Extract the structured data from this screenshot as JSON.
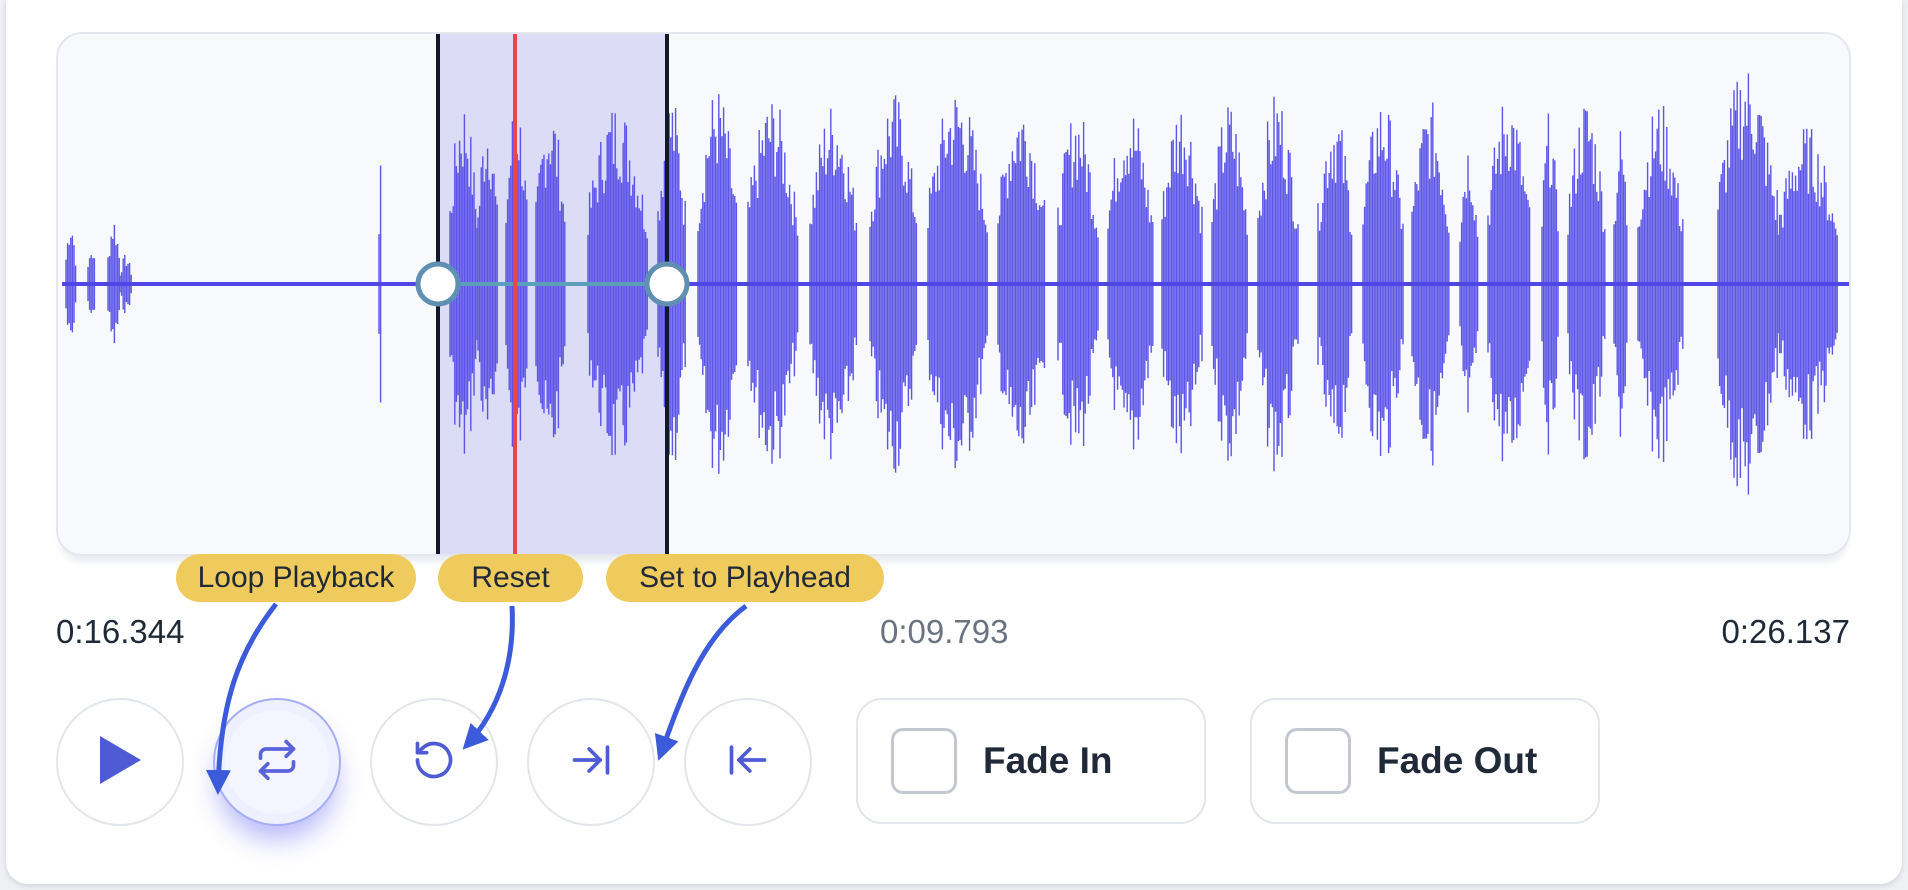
{
  "player": {
    "times": {
      "start": "0:16.344",
      "current": "0:09.793",
      "end": "0:26.137"
    },
    "controls": {
      "play_icon": "play-icon",
      "loop_icon": "loop-icon",
      "reset_icon": "reset-icon",
      "set_end_icon": "skip-to-end-icon",
      "set_start_icon": "skip-to-start-icon"
    },
    "fade_in": {
      "label": "Fade In",
      "checked": false
    },
    "fade_out": {
      "label": "Fade Out",
      "checked": false
    }
  },
  "annotations": [
    {
      "label": "Loop Playback"
    },
    {
      "label": "Reset"
    },
    {
      "label": "Set to Playhead"
    }
  ],
  "colors": {
    "waveform": "#4f46e5",
    "selection": "#dcdcf6",
    "playhead": "#ef4444",
    "annotation": "#efcb5e",
    "arrow": "#3b5bdb"
  }
}
